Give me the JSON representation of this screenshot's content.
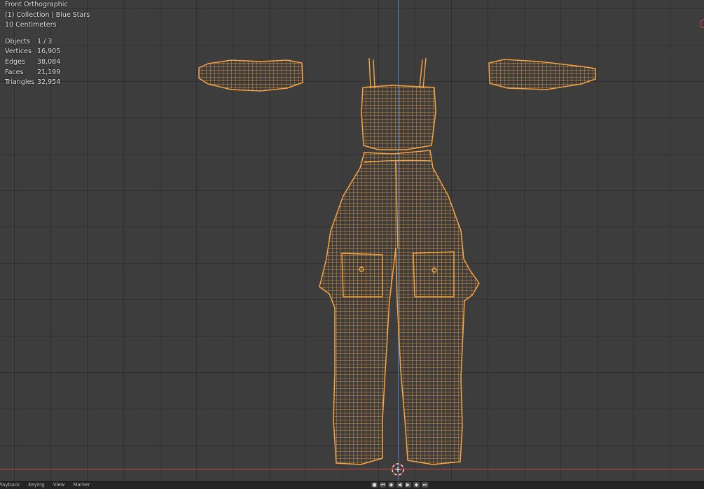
{
  "viewport": {
    "view_name": "Front Orthographic",
    "collection": "(1) Collection | Blue Stars",
    "scale": "10 Centimeters",
    "stats": [
      {
        "label": "Objects",
        "value": "1 / 3"
      },
      {
        "label": "Vertices",
        "value": "16,905"
      },
      {
        "label": "Edges",
        "value": "38,084"
      },
      {
        "label": "Faces",
        "value": "21,199"
      },
      {
        "label": "Triangles",
        "value": "32,954"
      }
    ],
    "mesh": {
      "name": "",
      "wire_color": "#f7a340",
      "icons": [
        "origin-icon"
      ]
    },
    "axis_colors": {
      "z": "#4f79b8",
      "x": "#c24a4a"
    },
    "grid_color": "#3d3d3d"
  },
  "timeline": {
    "menu": [
      "Playback",
      "Keying",
      "View",
      "Marker"
    ],
    "controls": [
      "record-icon",
      "jump-start-icon",
      "prev-key-icon",
      "play-reverse-icon",
      "play-icon",
      "next-key-icon",
      "jump-end-icon"
    ]
  }
}
